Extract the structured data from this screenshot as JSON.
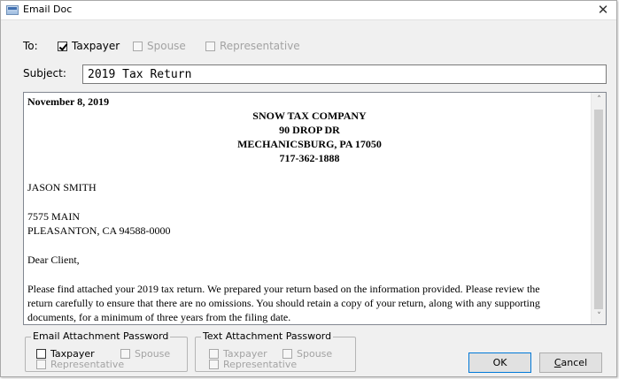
{
  "window": {
    "title": "Email Doc",
    "close_glyph": "✕"
  },
  "to": {
    "label": "To:",
    "recipients": [
      {
        "label": "Taxpayer",
        "checked": true,
        "enabled": true
      },
      {
        "label": "Spouse",
        "checked": false,
        "enabled": false
      },
      {
        "label": "Representative",
        "checked": false,
        "enabled": false
      }
    ]
  },
  "subject": {
    "label": "Subject:",
    "value": "2019 Tax Return"
  },
  "document": {
    "date": "November 8, 2019",
    "company_name": "SNOW TAX COMPANY",
    "company_address1": "90 DROP DR",
    "company_address2": "MECHANICSBURG, PA 17050",
    "company_phone": "717-362-1888",
    "client_name": "JASON SMITH",
    "client_address1": "7575 MAIN",
    "client_address2": "PLEASANTON, CA 94588-0000",
    "salutation": "Dear Client,",
    "body_line1": "Please find attached your 2019 tax return.  We prepared your return based on the information provided.  Please review the",
    "body_line2": "return carefully to ensure that there are no omissions.  You should retain a copy of your return, along with any supporting",
    "body_line3": "documents, for a minimum of three years from the filing date."
  },
  "scrollbar": {
    "up_glyph": "˄",
    "down_glyph": "˅"
  },
  "email_attachment_password": {
    "legend": "Email Attachment Password",
    "taxpayer": "Taxpayer",
    "spouse": "Spouse",
    "representative": "Representative"
  },
  "text_attachment_password": {
    "legend": "Text Attachment Password",
    "taxpayer": "Taxpayer",
    "spouse": "Spouse",
    "representative": "Representative"
  },
  "buttons": {
    "ok": "OK",
    "cancel_first": "C",
    "cancel_rest": "ancel"
  },
  "colors": {
    "disabled_text": "#a3a3a3",
    "ok_border": "#0078d7"
  }
}
